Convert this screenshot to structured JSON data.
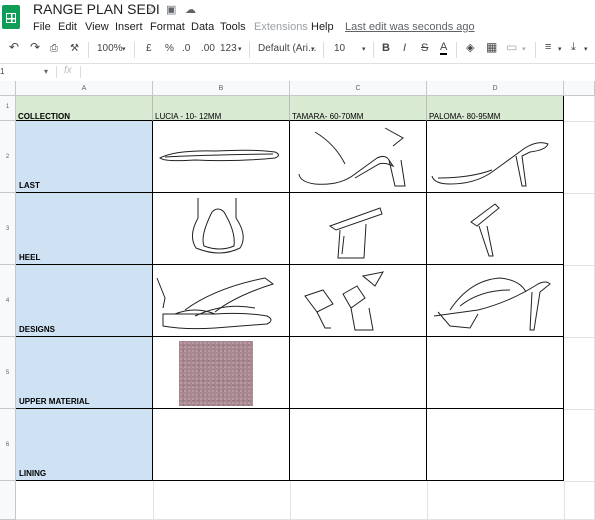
{
  "app": {
    "title": "RANGE PLAN SEDI",
    "last_edit": "Last edit was seconds ago"
  },
  "menu": [
    "File",
    "Edit",
    "View",
    "Insert",
    "Format",
    "Data",
    "Tools",
    "Extensions",
    "Help"
  ],
  "toolbar": {
    "zoom": "100%",
    "currency": "£",
    "percent": "%",
    "dec_down": ".0",
    "dec_up": ".00",
    "format_more": "123",
    "font": "Default (Ari...",
    "font_size": "10",
    "bold": "B",
    "italic": "I",
    "strike": "S",
    "text_color": "A"
  },
  "formula_bar": {
    "cell_ref": "1",
    "fx": "fx",
    "value": ""
  },
  "columns": [
    "A",
    "B",
    "C",
    "D"
  ],
  "rows": [
    "1",
    "2",
    "3",
    "4",
    "5",
    "6"
  ],
  "sheet": {
    "header_row": [
      "COLLECTION",
      "LUCIA - 10- 12MM",
      "TAMARA- 60-70MM",
      "PALOMA- 80-95MM"
    ],
    "row_labels": [
      "LAST",
      "HEEL",
      "DESIGNS",
      "UPPER MATERIAL",
      "LINING"
    ]
  },
  "colors": {
    "header_green": "#d9ead3",
    "label_blue": "#cfe2f3",
    "material_swatch": "#a88891"
  }
}
